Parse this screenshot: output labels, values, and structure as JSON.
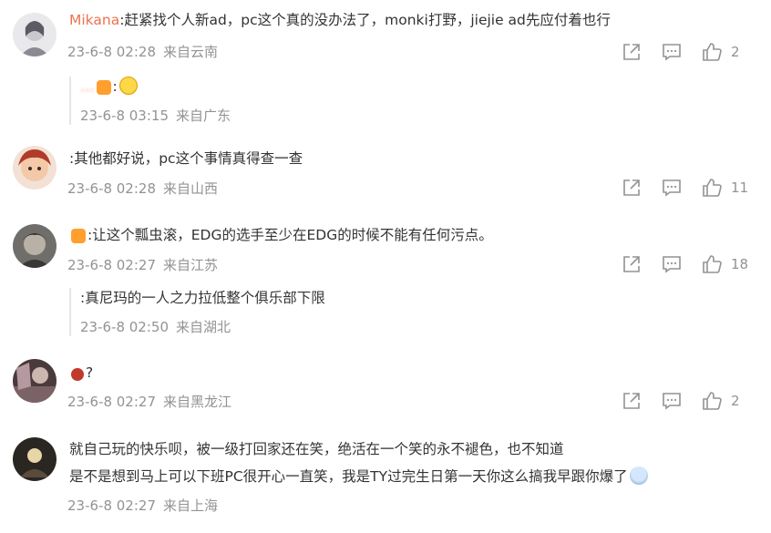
{
  "comments": [
    {
      "username": "Mikana",
      "text": ":赶紧找个人新ad，pc这个真的没办法了，monki打野，jiejie ad先应付着也行",
      "date": "23-6-8 02:28",
      "location": "来自云南",
      "likes": "2",
      "reply": {
        "username": "…",
        "text": ":",
        "date": "23-6-8 03:15",
        "location": "来自广东"
      }
    },
    {
      "username": "",
      "text": ":其他都好说，pc这个事情真得查一查",
      "date": "23-6-8 02:28",
      "location": "来自山西",
      "likes": "11"
    },
    {
      "username": "",
      "text": ":让这个瓢虫滚，EDG的选手至少在EDG的时候不能有任何污点。",
      "date": "23-6-8 02:27",
      "location": "来自江苏",
      "likes": "18",
      "reply": {
        "username": "",
        "text": ":真尼玛的一人之力拉低整个俱乐部下限",
        "date": "23-6-8 02:50",
        "location": "来自湖北"
      }
    },
    {
      "username": "",
      "text": "?",
      "date": "23-6-8 02:27",
      "location": "来自黑龙江",
      "likes": "2"
    },
    {
      "username": "",
      "text": "就自己玩的快乐呗，被一级打回家还在笑，绝活在一个笑的永不褪色，也不知道",
      "text2": "是不是想到马上可以下班PC很开心一直笑，我是TY过完生日第一天你这么搞我早跟你爆了",
      "date": "23-6-8 02:27",
      "location": "来自上海"
    }
  ],
  "colors": {
    "username": "#eb7350",
    "meta": "#939393",
    "text": "#333333"
  },
  "icons": [
    "share-icon",
    "comment-icon",
    "like-icon"
  ]
}
